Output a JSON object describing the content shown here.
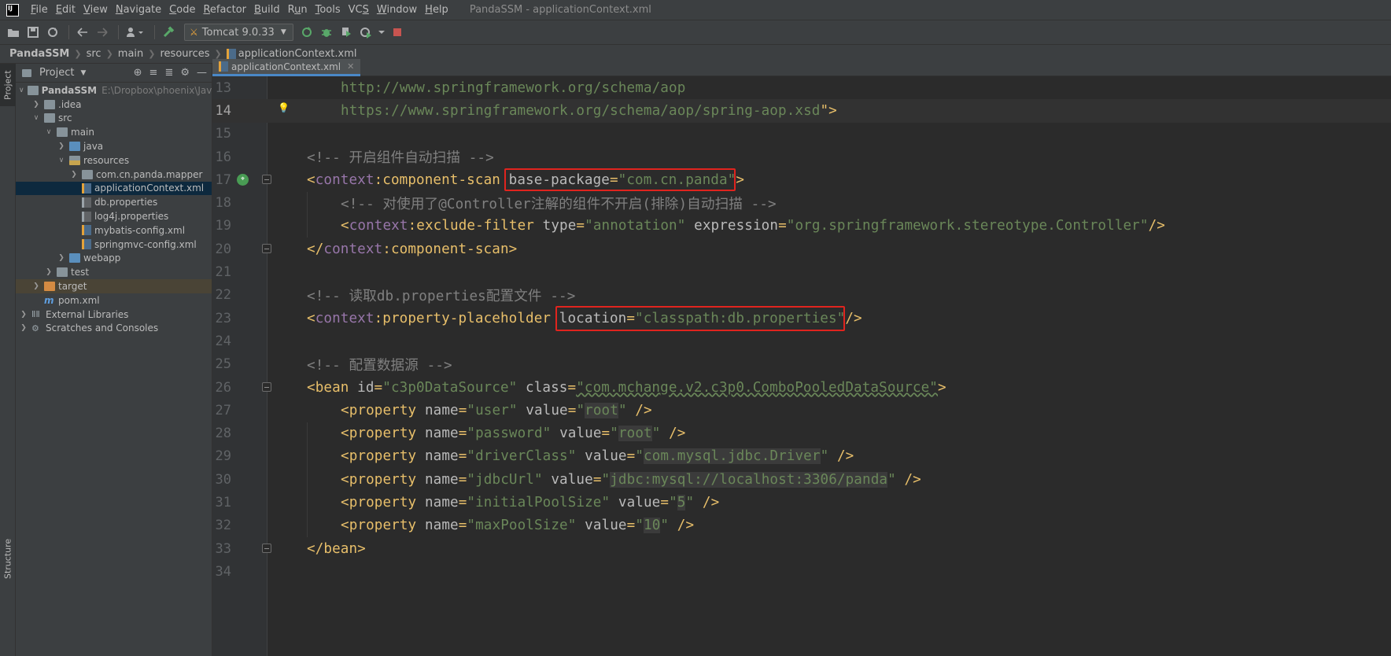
{
  "app": {
    "logo_text": "IJ",
    "window_title": "PandaSSM - applicationContext.xml"
  },
  "menu": [
    {
      "label": "File",
      "u": "F",
      "rest": "ile"
    },
    {
      "label": "Edit",
      "u": "E",
      "rest": "dit"
    },
    {
      "label": "View",
      "u": "V",
      "rest": "iew"
    },
    {
      "label": "Navigate",
      "u": "N",
      "rest": "avigate"
    },
    {
      "label": "Code",
      "u": "C",
      "rest": "ode"
    },
    {
      "label": "Refactor",
      "u": "R",
      "rest": "efactor"
    },
    {
      "label": "Build",
      "u": "B",
      "rest": "uild"
    },
    {
      "label": "Run",
      "u": "",
      "pre": "R",
      "u2": "u",
      "rest": "n"
    },
    {
      "label": "Tools",
      "u": "T",
      "rest": "ools"
    },
    {
      "label": "VCS",
      "u": "",
      "pre": "VC",
      "u2": "S",
      "rest": ""
    },
    {
      "label": "Window",
      "u": "W",
      "rest": "indow"
    },
    {
      "label": "Help",
      "u": "H",
      "rest": "elp"
    }
  ],
  "toolbar": {
    "run_config": "Tomcat 9.0.33"
  },
  "breadcrumbs": [
    "PandaSSM",
    "src",
    "main",
    "resources",
    "applicationContext.xml"
  ],
  "left_strip": {
    "project_tab": "Project",
    "structure_tab": "Structure"
  },
  "project_panel": {
    "title": "Project",
    "root_path": "E:\\Dropbox\\phoenix\\JavaPro",
    "tree": [
      {
        "label": "PandaSSM",
        "indent": 0,
        "toggle": "v",
        "icon": "folder",
        "bold": true
      },
      {
        "label": ".idea",
        "indent": 1,
        "toggle": ">",
        "icon": "folder"
      },
      {
        "label": "src",
        "indent": 1,
        "toggle": "v",
        "icon": "folder"
      },
      {
        "label": "main",
        "indent": 2,
        "toggle": "v",
        "icon": "folder"
      },
      {
        "label": "java",
        "indent": 3,
        "toggle": ">",
        "icon": "folder-blue"
      },
      {
        "label": "resources",
        "indent": 3,
        "toggle": "v",
        "icon": "folder-res"
      },
      {
        "label": "com.cn.panda.mapper",
        "indent": 4,
        "toggle": ">",
        "icon": "folder"
      },
      {
        "label": "applicationContext.xml",
        "indent": 4,
        "toggle": "",
        "icon": "xml",
        "selected": true
      },
      {
        "label": "db.properties",
        "indent": 4,
        "toggle": "",
        "icon": "prop"
      },
      {
        "label": "log4j.properties",
        "indent": 4,
        "toggle": "",
        "icon": "prop"
      },
      {
        "label": "mybatis-config.xml",
        "indent": 4,
        "toggle": "",
        "icon": "xml"
      },
      {
        "label": "springmvc-config.xml",
        "indent": 4,
        "toggle": "",
        "icon": "xml"
      },
      {
        "label": "webapp",
        "indent": 3,
        "toggle": ">",
        "icon": "folder-blue"
      },
      {
        "label": "test",
        "indent": 2,
        "toggle": ">",
        "icon": "folder"
      },
      {
        "label": "target",
        "indent": 1,
        "toggle": ">",
        "icon": "folder-orange",
        "excluded": true
      },
      {
        "label": "pom.xml",
        "indent": 1,
        "toggle": "",
        "icon": "maven"
      },
      {
        "label": "External Libraries",
        "indent": 0,
        "toggle": ">",
        "icon": "lib"
      },
      {
        "label": "Scratches and Consoles",
        "indent": 0,
        "toggle": ">",
        "icon": "scratch"
      }
    ]
  },
  "editor": {
    "tab_label": "applicationContext.xml",
    "lines": [
      {
        "n": "13",
        "segs": [
          [
            "st",
            "http://www.springframework.org/schema/aop"
          ]
        ],
        "indent": 1
      },
      {
        "n": "14",
        "current": true,
        "segs": [
          [
            "st",
            "https://www.springframework.org/schema/aop/spring-aop.xsd"
          ],
          [
            "tg",
            "\">"
          ]
        ],
        "indent": 1
      },
      {
        "n": "15",
        "segs": []
      },
      {
        "n": "16",
        "segs": [
          [
            "cm",
            "<!-- 开启组件自动扫描 -->"
          ]
        ],
        "indent": 0
      },
      {
        "n": "17",
        "segs": [
          [
            "tg",
            "<"
          ],
          [
            "ns",
            "context"
          ],
          [
            "tg",
            ":component-scan "
          ],
          [
            "at",
            "base-package"
          ],
          [
            "tg",
            "="
          ],
          [
            "st",
            "\"com.cn.panda\""
          ],
          [
            "tg",
            ">"
          ]
        ],
        "indent": 0
      },
      {
        "n": "18",
        "segs": [
          [
            "cm",
            "<!-- 对使用了@Controller注解的组件不开启(排除)自动扫描 -->"
          ]
        ],
        "indent": 1
      },
      {
        "n": "19",
        "segs": [
          [
            "tg",
            "<"
          ],
          [
            "ns",
            "context"
          ],
          [
            "tg",
            ":exclude-filter "
          ],
          [
            "at",
            "type"
          ],
          [
            "tg",
            "="
          ],
          [
            "st",
            "\"annotation\""
          ],
          [
            "tg",
            " "
          ],
          [
            "at",
            "expression"
          ],
          [
            "tg",
            "="
          ],
          [
            "st",
            "\"org.springframework.stereotype.Controller\""
          ],
          [
            "tg",
            "/>"
          ]
        ],
        "indent": 1
      },
      {
        "n": "20",
        "segs": [
          [
            "tg",
            "</"
          ],
          [
            "ns",
            "context"
          ],
          [
            "tg",
            ":component-scan>"
          ]
        ],
        "indent": 0
      },
      {
        "n": "21",
        "segs": []
      },
      {
        "n": "22",
        "segs": [
          [
            "cm",
            "<!-- 读取db.properties配置文件 -->"
          ]
        ],
        "indent": 0
      },
      {
        "n": "23",
        "segs": [
          [
            "tg",
            "<"
          ],
          [
            "ns",
            "context"
          ],
          [
            "tg",
            ":property-placeholder "
          ],
          [
            "at",
            "location"
          ],
          [
            "tg",
            "="
          ],
          [
            "st",
            "\"classpath:db.properties\""
          ],
          [
            "tg",
            "/>"
          ]
        ],
        "indent": 0
      },
      {
        "n": "24",
        "segs": []
      },
      {
        "n": "25",
        "segs": [
          [
            "cm",
            "<!-- 配置数据源 -->"
          ]
        ],
        "indent": 0
      },
      {
        "n": "26",
        "segs": [
          [
            "tg",
            "<bean "
          ],
          [
            "at",
            "id"
          ],
          [
            "tg",
            "="
          ],
          [
            "st",
            "\"c3p0DataSource\""
          ],
          [
            "tg",
            " "
          ],
          [
            "at",
            "class"
          ],
          [
            "tg",
            "="
          ],
          [
            "st",
            "\"com.mchange.v2.c3p0.ComboPooledDataSource\""
          ],
          [
            "tg",
            ">"
          ]
        ],
        "indent": 0
      },
      {
        "n": "27",
        "segs": [
          [
            "tg",
            "<property "
          ],
          [
            "at",
            "name"
          ],
          [
            "tg",
            "="
          ],
          [
            "st",
            "\"user\""
          ],
          [
            "tg",
            " "
          ],
          [
            "at",
            "value"
          ],
          [
            "tg",
            "="
          ],
          [
            "st",
            "\""
          ],
          [
            "hl",
            "root"
          ],
          [
            "st",
            "\""
          ],
          [
            "tg",
            " />"
          ]
        ],
        "indent": 1
      },
      {
        "n": "28",
        "segs": [
          [
            "tg",
            "<property "
          ],
          [
            "at",
            "name"
          ],
          [
            "tg",
            "="
          ],
          [
            "st",
            "\"password\""
          ],
          [
            "tg",
            " "
          ],
          [
            "at",
            "value"
          ],
          [
            "tg",
            "="
          ],
          [
            "st",
            "\""
          ],
          [
            "hl",
            "root"
          ],
          [
            "st",
            "\""
          ],
          [
            "tg",
            " />"
          ]
        ],
        "indent": 1
      },
      {
        "n": "29",
        "segs": [
          [
            "tg",
            "<property "
          ],
          [
            "at",
            "name"
          ],
          [
            "tg",
            "="
          ],
          [
            "st",
            "\"driverClass\""
          ],
          [
            "tg",
            " "
          ],
          [
            "at",
            "value"
          ],
          [
            "tg",
            "="
          ],
          [
            "st",
            "\""
          ],
          [
            "hl",
            "com.mysql.jdbc.Driver"
          ],
          [
            "st",
            "\""
          ],
          [
            "tg",
            " />"
          ]
        ],
        "indent": 1
      },
      {
        "n": "30",
        "segs": [
          [
            "tg",
            "<property "
          ],
          [
            "at",
            "name"
          ],
          [
            "tg",
            "="
          ],
          [
            "st",
            "\"jdbcUrl\""
          ],
          [
            "tg",
            " "
          ],
          [
            "at",
            "value"
          ],
          [
            "tg",
            "="
          ],
          [
            "st",
            "\""
          ],
          [
            "hl",
            "jdbc:mysql://localhost:3306/panda"
          ],
          [
            "st",
            "\""
          ],
          [
            "tg",
            " />"
          ]
        ],
        "indent": 1
      },
      {
        "n": "31",
        "segs": [
          [
            "tg",
            "<property "
          ],
          [
            "at",
            "name"
          ],
          [
            "tg",
            "="
          ],
          [
            "st",
            "\"initialPoolSize\""
          ],
          [
            "tg",
            " "
          ],
          [
            "at",
            "value"
          ],
          [
            "tg",
            "="
          ],
          [
            "st",
            "\""
          ],
          [
            "hl",
            "5"
          ],
          [
            "st",
            "\""
          ],
          [
            "tg",
            " />"
          ]
        ],
        "indent": 1
      },
      {
        "n": "32",
        "segs": [
          [
            "tg",
            "<property "
          ],
          [
            "at",
            "name"
          ],
          [
            "tg",
            "="
          ],
          [
            "st",
            "\"maxPoolSize\""
          ],
          [
            "tg",
            " "
          ],
          [
            "at",
            "value"
          ],
          [
            "tg",
            "="
          ],
          [
            "st",
            "\""
          ],
          [
            "hl",
            "10"
          ],
          [
            "st",
            "\""
          ],
          [
            "tg",
            " />"
          ]
        ],
        "indent": 1
      },
      {
        "n": "33",
        "segs": [
          [
            "tg",
            "</bean>"
          ]
        ],
        "indent": 0
      },
      {
        "n": "34",
        "segs": []
      }
    ]
  },
  "colors": {
    "annotation_box": "#e0241e",
    "tag": "#e8bf6a",
    "namespace": "#9876aa",
    "string": "#6a8759",
    "comment": "#808080"
  }
}
